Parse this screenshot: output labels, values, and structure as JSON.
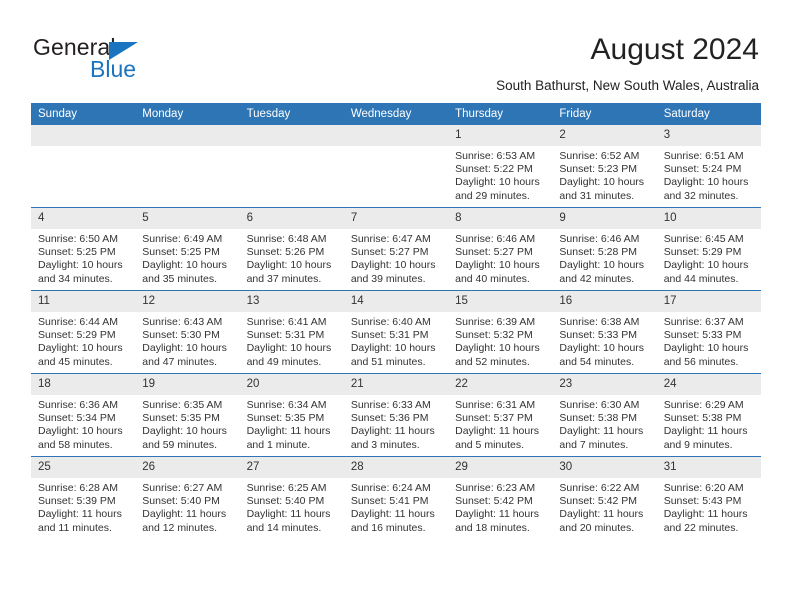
{
  "brand": {
    "word_one": "General",
    "word_two": "Blue",
    "accent_color": "#1b74c0"
  },
  "header": {
    "title": "August 2024",
    "subtitle": "South Bathurst, New South Wales, Australia",
    "header_bg": "#2e75b6"
  },
  "weekdays": [
    "Sunday",
    "Monday",
    "Tuesday",
    "Wednesday",
    "Thursday",
    "Friday",
    "Saturday"
  ],
  "weeks": [
    [
      {
        "day": "",
        "empty": true
      },
      {
        "day": "",
        "empty": true
      },
      {
        "day": "",
        "empty": true
      },
      {
        "day": "",
        "empty": true
      },
      {
        "day": "1",
        "sunrise": "Sunrise: 6:53 AM",
        "sunset": "Sunset: 5:22 PM",
        "daylight_1": "Daylight: 10 hours",
        "daylight_2": "and 29 minutes."
      },
      {
        "day": "2",
        "sunrise": "Sunrise: 6:52 AM",
        "sunset": "Sunset: 5:23 PM",
        "daylight_1": "Daylight: 10 hours",
        "daylight_2": "and 31 minutes."
      },
      {
        "day": "3",
        "sunrise": "Sunrise: 6:51 AM",
        "sunset": "Sunset: 5:24 PM",
        "daylight_1": "Daylight: 10 hours",
        "daylight_2": "and 32 minutes."
      }
    ],
    [
      {
        "day": "4",
        "sunrise": "Sunrise: 6:50 AM",
        "sunset": "Sunset: 5:25 PM",
        "daylight_1": "Daylight: 10 hours",
        "daylight_2": "and 34 minutes."
      },
      {
        "day": "5",
        "sunrise": "Sunrise: 6:49 AM",
        "sunset": "Sunset: 5:25 PM",
        "daylight_1": "Daylight: 10 hours",
        "daylight_2": "and 35 minutes."
      },
      {
        "day": "6",
        "sunrise": "Sunrise: 6:48 AM",
        "sunset": "Sunset: 5:26 PM",
        "daylight_1": "Daylight: 10 hours",
        "daylight_2": "and 37 minutes."
      },
      {
        "day": "7",
        "sunrise": "Sunrise: 6:47 AM",
        "sunset": "Sunset: 5:27 PM",
        "daylight_1": "Daylight: 10 hours",
        "daylight_2": "and 39 minutes."
      },
      {
        "day": "8",
        "sunrise": "Sunrise: 6:46 AM",
        "sunset": "Sunset: 5:27 PM",
        "daylight_1": "Daylight: 10 hours",
        "daylight_2": "and 40 minutes."
      },
      {
        "day": "9",
        "sunrise": "Sunrise: 6:46 AM",
        "sunset": "Sunset: 5:28 PM",
        "daylight_1": "Daylight: 10 hours",
        "daylight_2": "and 42 minutes."
      },
      {
        "day": "10",
        "sunrise": "Sunrise: 6:45 AM",
        "sunset": "Sunset: 5:29 PM",
        "daylight_1": "Daylight: 10 hours",
        "daylight_2": "and 44 minutes."
      }
    ],
    [
      {
        "day": "11",
        "sunrise": "Sunrise: 6:44 AM",
        "sunset": "Sunset: 5:29 PM",
        "daylight_1": "Daylight: 10 hours",
        "daylight_2": "and 45 minutes."
      },
      {
        "day": "12",
        "sunrise": "Sunrise: 6:43 AM",
        "sunset": "Sunset: 5:30 PM",
        "daylight_1": "Daylight: 10 hours",
        "daylight_2": "and 47 minutes."
      },
      {
        "day": "13",
        "sunrise": "Sunrise: 6:41 AM",
        "sunset": "Sunset: 5:31 PM",
        "daylight_1": "Daylight: 10 hours",
        "daylight_2": "and 49 minutes."
      },
      {
        "day": "14",
        "sunrise": "Sunrise: 6:40 AM",
        "sunset": "Sunset: 5:31 PM",
        "daylight_1": "Daylight: 10 hours",
        "daylight_2": "and 51 minutes."
      },
      {
        "day": "15",
        "sunrise": "Sunrise: 6:39 AM",
        "sunset": "Sunset: 5:32 PM",
        "daylight_1": "Daylight: 10 hours",
        "daylight_2": "and 52 minutes."
      },
      {
        "day": "16",
        "sunrise": "Sunrise: 6:38 AM",
        "sunset": "Sunset: 5:33 PM",
        "daylight_1": "Daylight: 10 hours",
        "daylight_2": "and 54 minutes."
      },
      {
        "day": "17",
        "sunrise": "Sunrise: 6:37 AM",
        "sunset": "Sunset: 5:33 PM",
        "daylight_1": "Daylight: 10 hours",
        "daylight_2": "and 56 minutes."
      }
    ],
    [
      {
        "day": "18",
        "sunrise": "Sunrise: 6:36 AM",
        "sunset": "Sunset: 5:34 PM",
        "daylight_1": "Daylight: 10 hours",
        "daylight_2": "and 58 minutes."
      },
      {
        "day": "19",
        "sunrise": "Sunrise: 6:35 AM",
        "sunset": "Sunset: 5:35 PM",
        "daylight_1": "Daylight: 10 hours",
        "daylight_2": "and 59 minutes."
      },
      {
        "day": "20",
        "sunrise": "Sunrise: 6:34 AM",
        "sunset": "Sunset: 5:35 PM",
        "daylight_1": "Daylight: 11 hours",
        "daylight_2": "and 1 minute."
      },
      {
        "day": "21",
        "sunrise": "Sunrise: 6:33 AM",
        "sunset": "Sunset: 5:36 PM",
        "daylight_1": "Daylight: 11 hours",
        "daylight_2": "and 3 minutes."
      },
      {
        "day": "22",
        "sunrise": "Sunrise: 6:31 AM",
        "sunset": "Sunset: 5:37 PM",
        "daylight_1": "Daylight: 11 hours",
        "daylight_2": "and 5 minutes."
      },
      {
        "day": "23",
        "sunrise": "Sunrise: 6:30 AM",
        "sunset": "Sunset: 5:38 PM",
        "daylight_1": "Daylight: 11 hours",
        "daylight_2": "and 7 minutes."
      },
      {
        "day": "24",
        "sunrise": "Sunrise: 6:29 AM",
        "sunset": "Sunset: 5:38 PM",
        "daylight_1": "Daylight: 11 hours",
        "daylight_2": "and 9 minutes."
      }
    ],
    [
      {
        "day": "25",
        "sunrise": "Sunrise: 6:28 AM",
        "sunset": "Sunset: 5:39 PM",
        "daylight_1": "Daylight: 11 hours",
        "daylight_2": "and 11 minutes."
      },
      {
        "day": "26",
        "sunrise": "Sunrise: 6:27 AM",
        "sunset": "Sunset: 5:40 PM",
        "daylight_1": "Daylight: 11 hours",
        "daylight_2": "and 12 minutes."
      },
      {
        "day": "27",
        "sunrise": "Sunrise: 6:25 AM",
        "sunset": "Sunset: 5:40 PM",
        "daylight_1": "Daylight: 11 hours",
        "daylight_2": "and 14 minutes."
      },
      {
        "day": "28",
        "sunrise": "Sunrise: 6:24 AM",
        "sunset": "Sunset: 5:41 PM",
        "daylight_1": "Daylight: 11 hours",
        "daylight_2": "and 16 minutes."
      },
      {
        "day": "29",
        "sunrise": "Sunrise: 6:23 AM",
        "sunset": "Sunset: 5:42 PM",
        "daylight_1": "Daylight: 11 hours",
        "daylight_2": "and 18 minutes."
      },
      {
        "day": "30",
        "sunrise": "Sunrise: 6:22 AM",
        "sunset": "Sunset: 5:42 PM",
        "daylight_1": "Daylight: 11 hours",
        "daylight_2": "and 20 minutes."
      },
      {
        "day": "31",
        "sunrise": "Sunrise: 6:20 AM",
        "sunset": "Sunset: 5:43 PM",
        "daylight_1": "Daylight: 11 hours",
        "daylight_2": "and 22 minutes."
      }
    ]
  ]
}
